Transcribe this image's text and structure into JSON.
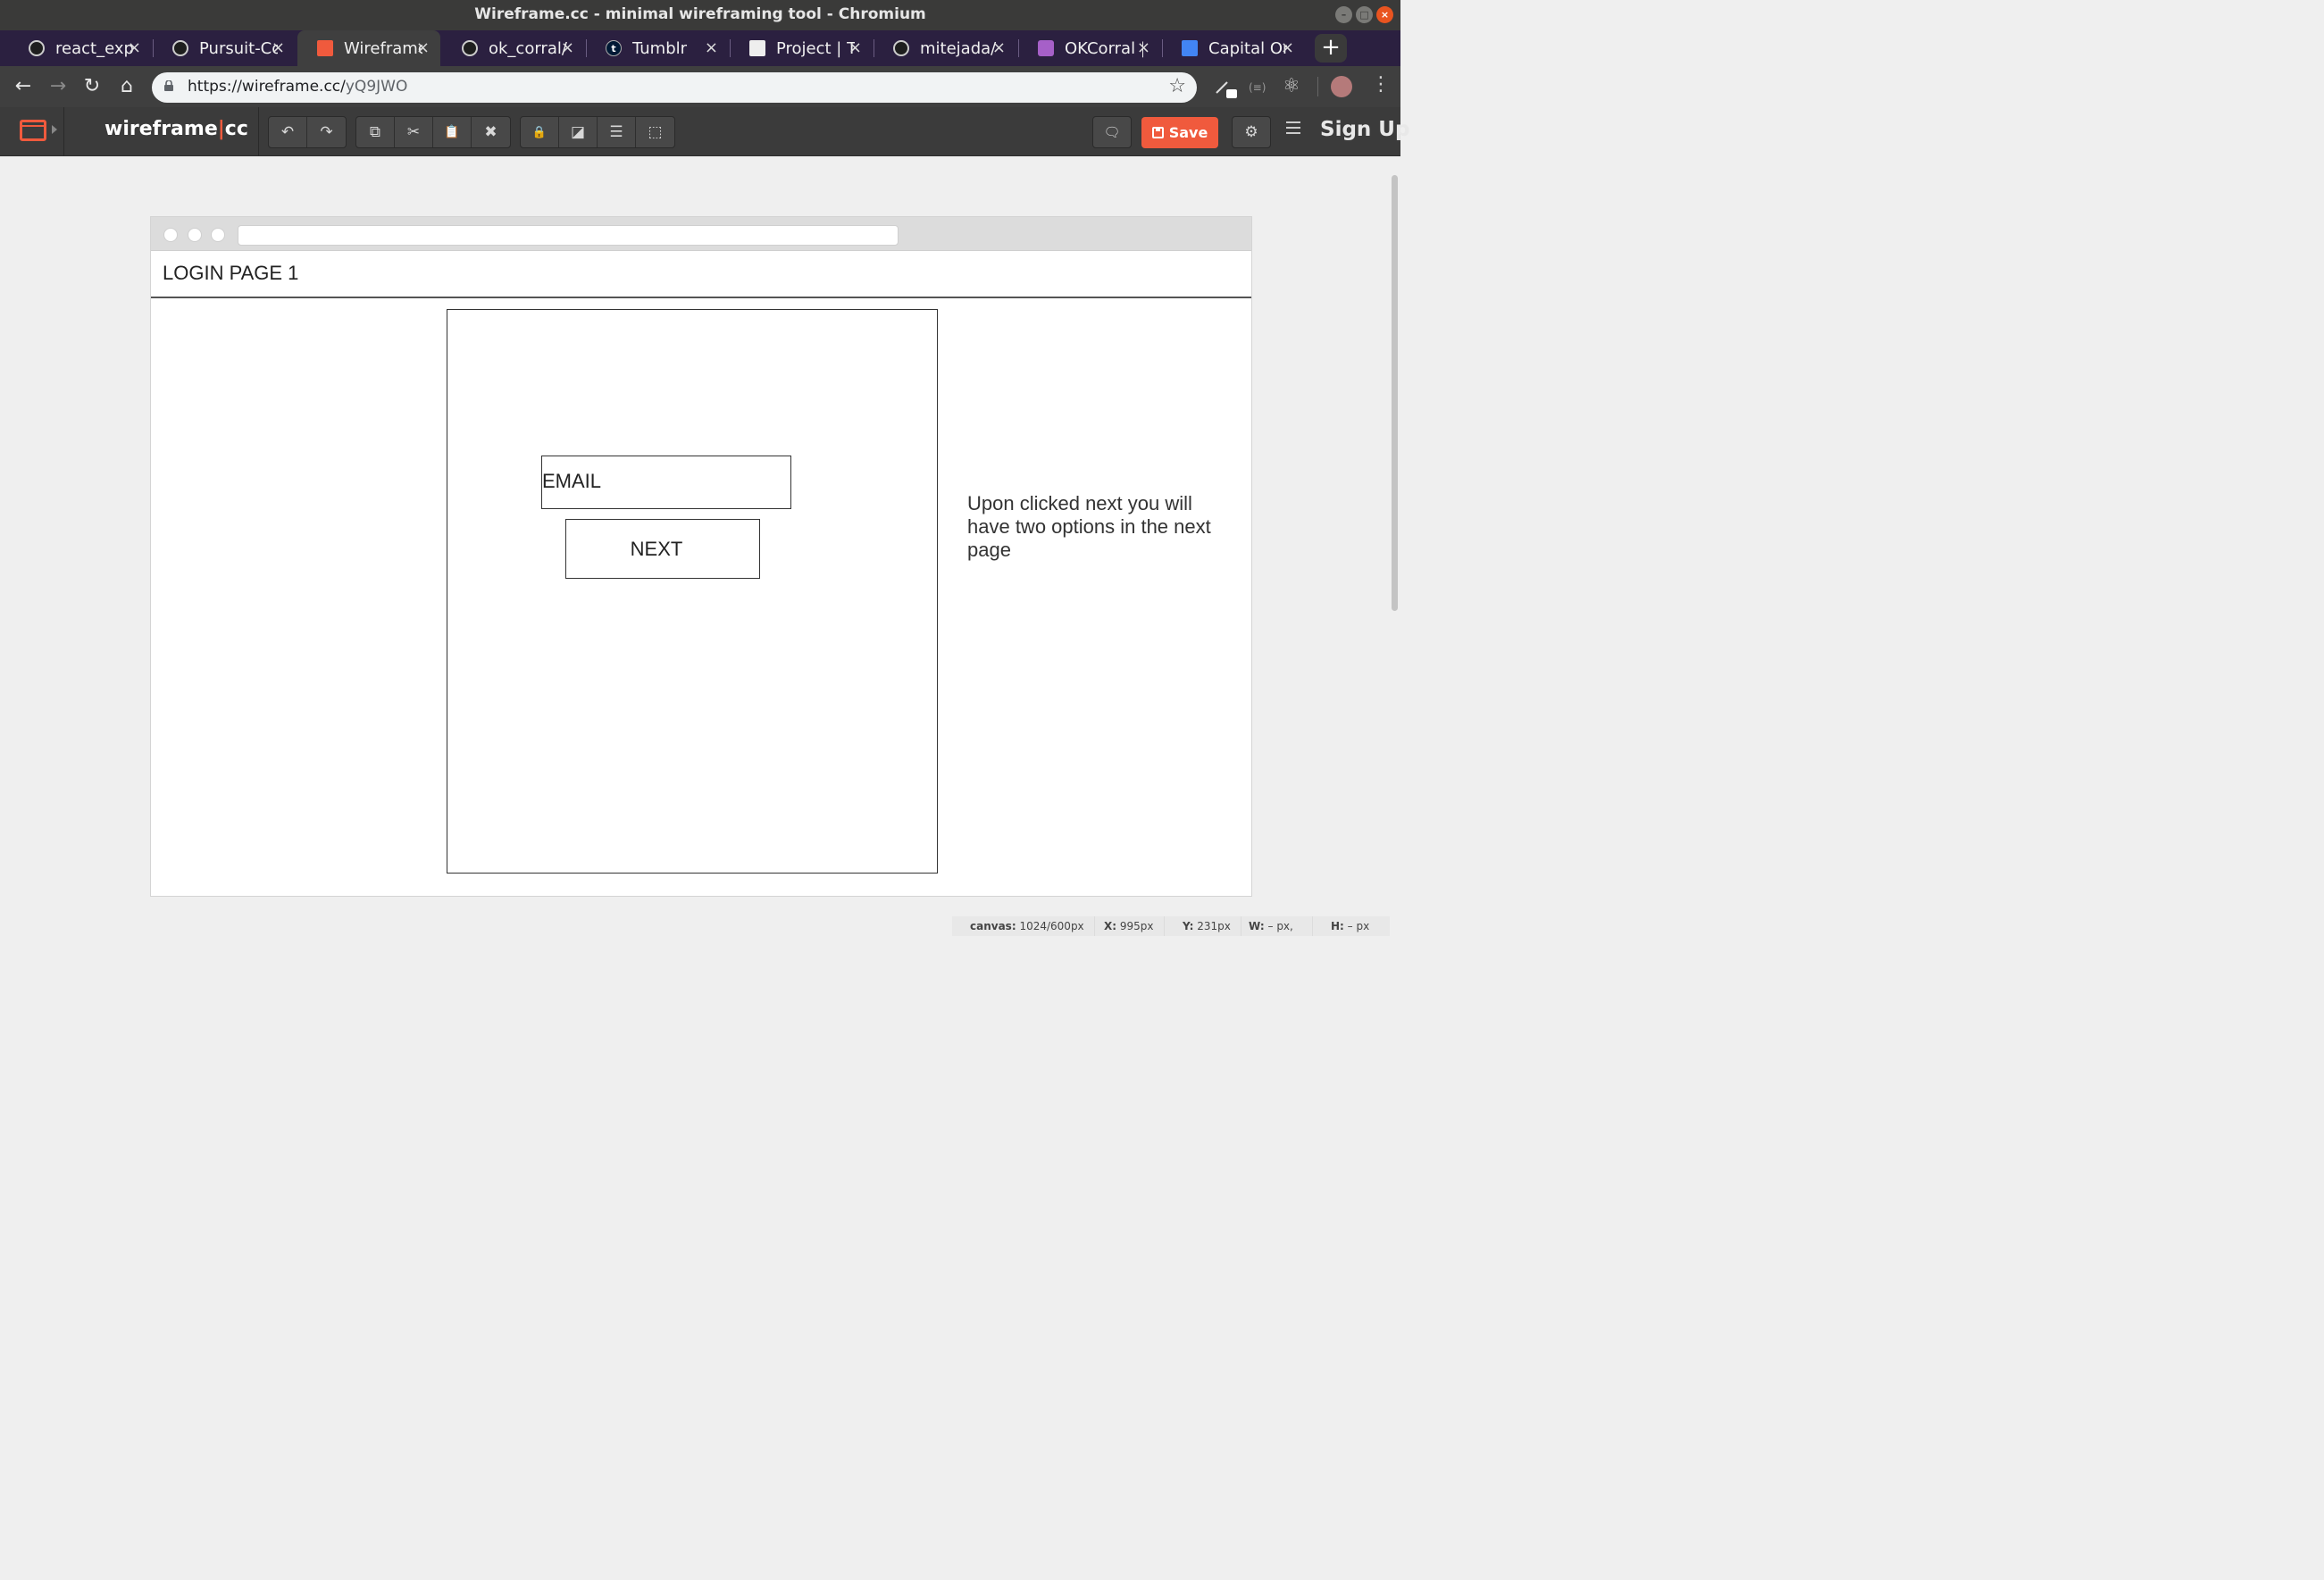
{
  "window": {
    "title": "Wireframe.cc - minimal wireframing tool - Chromium"
  },
  "tabs": [
    {
      "label": "react_exp",
      "icon": "github-icon",
      "active": false
    },
    {
      "label": "Pursuit-Co",
      "icon": "github-icon",
      "active": false
    },
    {
      "label": "Wireframe",
      "icon": "wireframe-icon",
      "active": true
    },
    {
      "label": "ok_corral/",
      "icon": "github-icon",
      "active": false
    },
    {
      "label": "Tumblr",
      "icon": "tumblr-icon",
      "active": false
    },
    {
      "label": "Project | T",
      "icon": "trello-icon",
      "active": false
    },
    {
      "label": "mitejada/",
      "icon": "github-icon",
      "active": false
    },
    {
      "label": "OKCorral |",
      "icon": "trello-icon",
      "active": false
    },
    {
      "label": "Capital On",
      "icon": "google-docs-icon",
      "active": false
    }
  ],
  "tab_glyphs": {
    "close": "×",
    "new_tab": "+",
    "tumblr": "t"
  },
  "address": {
    "scheme_host": "https://wireframe.cc/",
    "path": "yQ9JWO"
  },
  "nav_glyphs": {
    "back": "←",
    "forward": "→",
    "reload": "↻",
    "home": "⌂",
    "star": "☆",
    "menu": "⋮",
    "react": "⚛",
    "ext": "(≡)"
  },
  "app": {
    "brand_left": "wireframe",
    "brand_pipe": "|",
    "brand_right": "cc",
    "save_label": "Save",
    "signup_label": "Sign Up",
    "toolbar_glyphs": {
      "undo": "↶",
      "redo": "↷",
      "copy": "⧉",
      "cut": "✂",
      "paste": "📋",
      "delete": "✖",
      "lock": "🔒",
      "arrange": "◪",
      "align": "☰",
      "group": "⬚",
      "comment": "🗨",
      "settings": "⚙"
    }
  },
  "canvas": {
    "page_title": "LOGIN PAGE 1",
    "email_label": "EMAIL",
    "next_label": "NEXT",
    "note": "Upon clicked next you will have two options in the next page"
  },
  "status": {
    "canvas_label": "canvas:",
    "canvas_value": "1024/600px",
    "x_label": "X:",
    "x_value": "995px",
    "y_label": "Y:",
    "y_value": "231px",
    "w_label": "W:",
    "w_value": "– px,",
    "h_label": "H:",
    "h_value": "– px"
  },
  "colors": {
    "accent": "#f05a3d",
    "tab_strip": "#2b2040",
    "toolbar": "#3b3b3b",
    "canvas_bg": "#efefef"
  }
}
